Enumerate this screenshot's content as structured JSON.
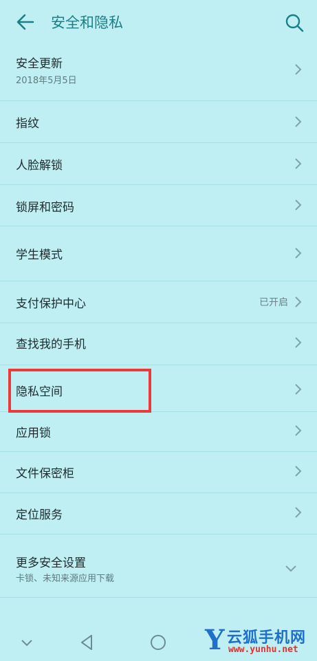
{
  "header": {
    "title": "安全和隐私"
  },
  "items": [
    {
      "label": "安全更新",
      "sub": "2018年5月5日"
    },
    {
      "label": "指纹"
    },
    {
      "label": "人脸解锁"
    },
    {
      "label": "锁屏和密码"
    },
    {
      "label": "学生模式"
    },
    {
      "label": "支付保护中心",
      "status": "已开启"
    },
    {
      "label": "查找我的手机"
    },
    {
      "label": "隐私空间"
    },
    {
      "label": "应用锁"
    },
    {
      "label": "文件保密柜"
    },
    {
      "label": "定位服务"
    },
    {
      "label": "更多安全设置",
      "sub": "卡锁、未知来源应用下载"
    }
  ],
  "watermark": {
    "brand_letter": "Y",
    "brand_name": "云狐手机网",
    "url": "www.yunhu.net"
  },
  "colors": {
    "background": "#bfeff2",
    "accent": "#1b7f88",
    "highlight_box": "#ec3a3a"
  }
}
